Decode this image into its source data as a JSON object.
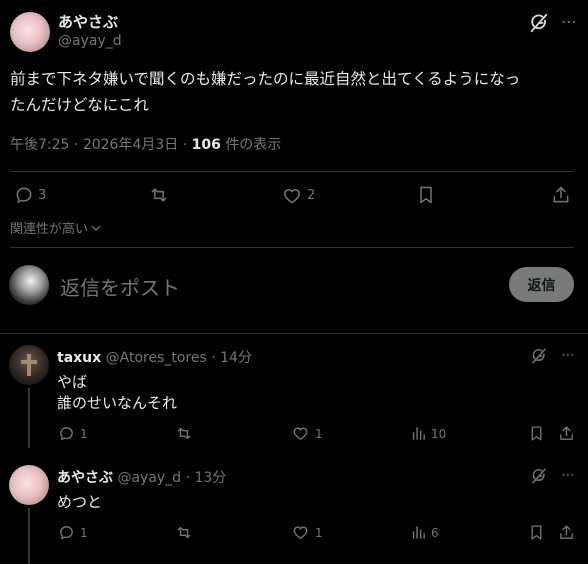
{
  "post": {
    "display_name": "あやさぶ",
    "handle": "@ayay_d",
    "text_line1": "前まで下ネタ嫌いで聞くのも嫌だったのに最近自然と出てくるようになっ",
    "text_line2": "たんだけどなにこれ",
    "time": "午後7:25",
    "date": "2026年4月3日",
    "views_count": "106",
    "views_label": "件の表示",
    "reply_count": "3",
    "like_count": "2"
  },
  "sort": {
    "label": "関連性が高い"
  },
  "compose": {
    "placeholder": "返信をポスト",
    "button_label": "返信"
  },
  "replies": [
    {
      "display_name": "taxux",
      "handle": "@Atores_tores",
      "time": "14分",
      "line1": "やば",
      "line2": "誰のせいなんそれ",
      "reply_count": "1",
      "like_count": "1",
      "view_count": "10"
    },
    {
      "display_name": "あやさぶ",
      "handle": "@ayay_d",
      "time": "13分",
      "line1": "めつと",
      "reply_count": "1",
      "like_count": "1",
      "view_count": "6"
    }
  ],
  "colors": {
    "background": "#000000",
    "text": "#e7e9ea",
    "muted": "#71767b",
    "divider": "#2f3336",
    "button": "#787a7a"
  },
  "icons": [
    "grok-icon",
    "reply-icon",
    "repost-icon",
    "like-icon",
    "bookmark-icon",
    "share-icon",
    "views-icon",
    "chevron-down-icon"
  ]
}
